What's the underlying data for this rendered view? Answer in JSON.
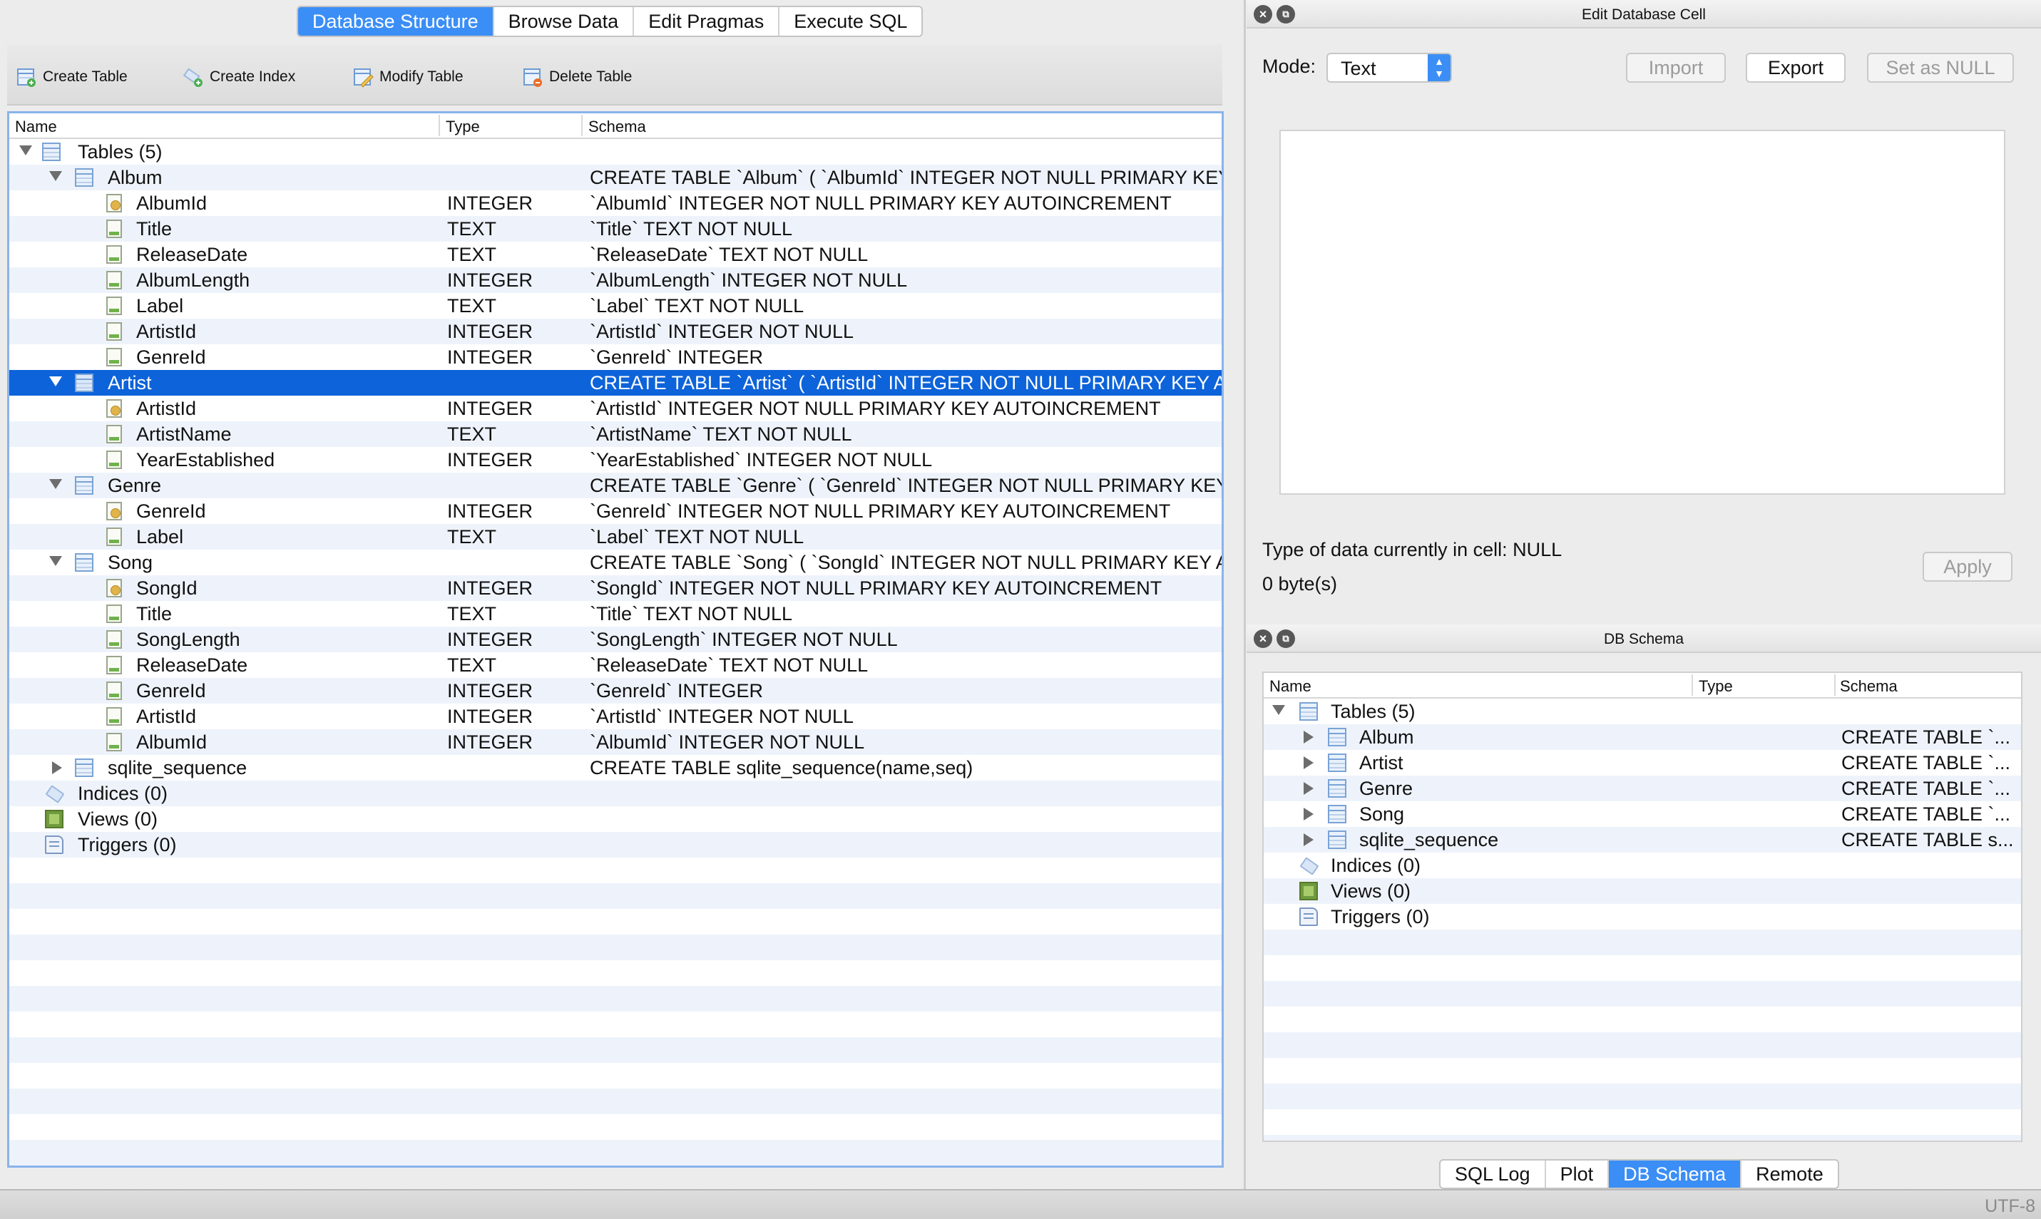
{
  "main_tabs": [
    "Database Structure",
    "Browse Data",
    "Edit Pragmas",
    "Execute SQL"
  ],
  "toolbar": {
    "create_table": "Create Table",
    "create_index": "Create Index",
    "modify_table": "Modify Table",
    "delete_table": "Delete Table"
  },
  "tree": {
    "columns": [
      "Name",
      "Type",
      "Schema"
    ],
    "rows": [
      {
        "name": "Tables (5)",
        "type": "",
        "schema": ""
      },
      {
        "name": "Album",
        "type": "",
        "schema": "CREATE TABLE `Album` ( `AlbumId` INTEGER NOT NULL PRIMARY KEY"
      },
      {
        "name": "AlbumId",
        "type": "INTEGER",
        "schema": "`AlbumId` INTEGER NOT NULL PRIMARY KEY AUTOINCREMENT"
      },
      {
        "name": "Title",
        "type": "TEXT",
        "schema": "`Title` TEXT NOT NULL"
      },
      {
        "name": "ReleaseDate",
        "type": "TEXT",
        "schema": "`ReleaseDate` TEXT NOT NULL"
      },
      {
        "name": "AlbumLength",
        "type": "INTEGER",
        "schema": "`AlbumLength` INTEGER NOT NULL"
      },
      {
        "name": "Label",
        "type": "TEXT",
        "schema": "`Label` TEXT NOT NULL"
      },
      {
        "name": "ArtistId",
        "type": "INTEGER",
        "schema": "`ArtistId` INTEGER NOT NULL"
      },
      {
        "name": "GenreId",
        "type": "INTEGER",
        "schema": "`GenreId` INTEGER"
      },
      {
        "name": "Artist",
        "type": "",
        "schema": "CREATE TABLE `Artist` ( `ArtistId` INTEGER NOT NULL PRIMARY KEY AU"
      },
      {
        "name": "ArtistId",
        "type": "INTEGER",
        "schema": "`ArtistId` INTEGER NOT NULL PRIMARY KEY AUTOINCREMENT"
      },
      {
        "name": "ArtistName",
        "type": "TEXT",
        "schema": "`ArtistName` TEXT NOT NULL"
      },
      {
        "name": "YearEstablished",
        "type": "INTEGER",
        "schema": "`YearEstablished` INTEGER NOT NULL"
      },
      {
        "name": "Genre",
        "type": "",
        "schema": "CREATE TABLE `Genre` ( `GenreId` INTEGER NOT NULL PRIMARY KEY A"
      },
      {
        "name": "GenreId",
        "type": "INTEGER",
        "schema": "`GenreId` INTEGER NOT NULL PRIMARY KEY AUTOINCREMENT"
      },
      {
        "name": "Label",
        "type": "TEXT",
        "schema": "`Label` TEXT NOT NULL"
      },
      {
        "name": "Song",
        "type": "",
        "schema": "CREATE TABLE `Song` ( `SongId` INTEGER NOT NULL PRIMARY KEY AU"
      },
      {
        "name": "SongId",
        "type": "INTEGER",
        "schema": "`SongId` INTEGER NOT NULL PRIMARY KEY AUTOINCREMENT"
      },
      {
        "name": "Title",
        "type": "TEXT",
        "schema": "`Title` TEXT NOT NULL"
      },
      {
        "name": "SongLength",
        "type": "INTEGER",
        "schema": "`SongLength` INTEGER NOT NULL"
      },
      {
        "name": "ReleaseDate",
        "type": "TEXT",
        "schema": "`ReleaseDate` TEXT NOT NULL"
      },
      {
        "name": "GenreId",
        "type": "INTEGER",
        "schema": "`GenreId` INTEGER"
      },
      {
        "name": "ArtistId",
        "type": "INTEGER",
        "schema": "`ArtistId` INTEGER NOT NULL"
      },
      {
        "name": "AlbumId",
        "type": "INTEGER",
        "schema": "`AlbumId` INTEGER NOT NULL"
      },
      {
        "name": "sqlite_sequence",
        "type": "",
        "schema": "CREATE TABLE sqlite_sequence(name,seq)"
      },
      {
        "name": "Indices (0)",
        "type": "",
        "schema": ""
      },
      {
        "name": "Views (0)",
        "type": "",
        "schema": ""
      },
      {
        "name": "Triggers (0)",
        "type": "",
        "schema": ""
      }
    ]
  },
  "edit_cell": {
    "title": "Edit Database Cell",
    "mode_label": "Mode:",
    "mode_value": "Text",
    "import_label": "Import",
    "export_label": "Export",
    "set_null_label": "Set as NULL",
    "type_info": "Type of data currently in cell: NULL",
    "size_info": "0 byte(s)",
    "apply_label": "Apply"
  },
  "db_schema": {
    "title": "DB Schema",
    "columns": [
      "Name",
      "Type",
      "Schema"
    ],
    "rows": [
      {
        "name": "Tables (5)",
        "schema": ""
      },
      {
        "name": "Album",
        "schema": "CREATE TABLE `..."
      },
      {
        "name": "Artist",
        "schema": "CREATE TABLE `..."
      },
      {
        "name": "Genre",
        "schema": "CREATE TABLE `..."
      },
      {
        "name": "Song",
        "schema": "CREATE TABLE `..."
      },
      {
        "name": "sqlite_sequence",
        "schema": "CREATE TABLE s..."
      },
      {
        "name": "Indices (0)",
        "schema": ""
      },
      {
        "name": "Views (0)",
        "schema": ""
      },
      {
        "name": "Triggers (0)",
        "schema": ""
      }
    ]
  },
  "bottom_tabs": [
    "SQL Log",
    "Plot",
    "DB Schema",
    "Remote"
  ],
  "status": {
    "encoding": "UTF-8"
  },
  "colors": {
    "accent": "#3b8ef5",
    "selection": "#0d63d9"
  }
}
